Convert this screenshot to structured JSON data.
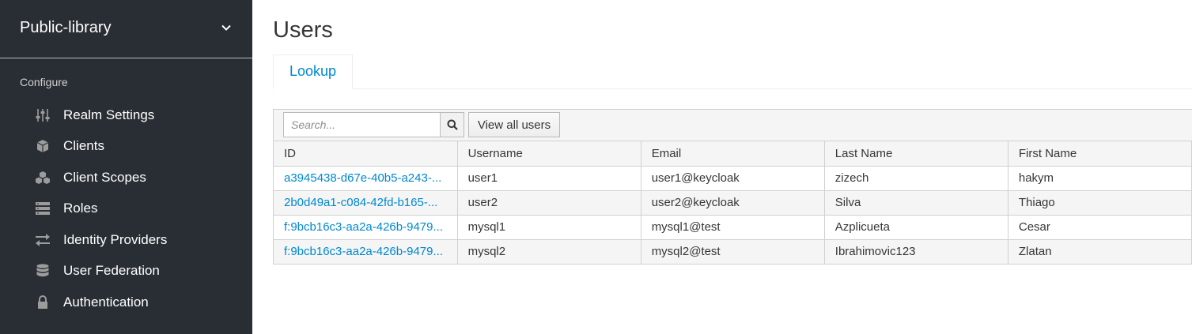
{
  "sidebar": {
    "realm_name": "Public-library",
    "section_label": "Configure",
    "items": [
      {
        "label": "Realm Settings",
        "icon": "sliders-icon"
      },
      {
        "label": "Clients",
        "icon": "cube-icon"
      },
      {
        "label": "Client Scopes",
        "icon": "cubes-icon"
      },
      {
        "label": "Roles",
        "icon": "list-icon"
      },
      {
        "label": "Identity Providers",
        "icon": "exchange-icon"
      },
      {
        "label": "User Federation",
        "icon": "database-icon"
      },
      {
        "label": "Authentication",
        "icon": "lock-icon"
      }
    ]
  },
  "main": {
    "title": "Users",
    "tabs": [
      {
        "label": "Lookup"
      }
    ],
    "search": {
      "placeholder": "Search...",
      "value": ""
    },
    "view_all_label": "View all users",
    "columns": [
      "ID",
      "Username",
      "Email",
      "Last Name",
      "First Name"
    ],
    "rows": [
      {
        "id": "a3945438-d67e-40b5-a243-...",
        "username": "user1",
        "email": "user1@keycloak",
        "last_name": "zizech",
        "first_name": "hakym"
      },
      {
        "id": "2b0d49a1-c084-42fd-b165-...",
        "username": "user2",
        "email": "user2@keycloak",
        "last_name": "Silva",
        "first_name": "Thiago"
      },
      {
        "id": "f:9bcb16c3-aa2a-426b-9479...",
        "username": "mysql1",
        "email": "mysql1@test",
        "last_name": "Azplicueta",
        "first_name": "Cesar"
      },
      {
        "id": "f:9bcb16c3-aa2a-426b-9479...",
        "username": "mysql2",
        "email": "mysql2@test",
        "last_name": "Ibrahimovic123",
        "first_name": "Zlatan"
      }
    ]
  },
  "colors": {
    "sidebar_bg": "#292e34",
    "link": "#0088ce",
    "table_stripe": "#f5f5f5"
  }
}
